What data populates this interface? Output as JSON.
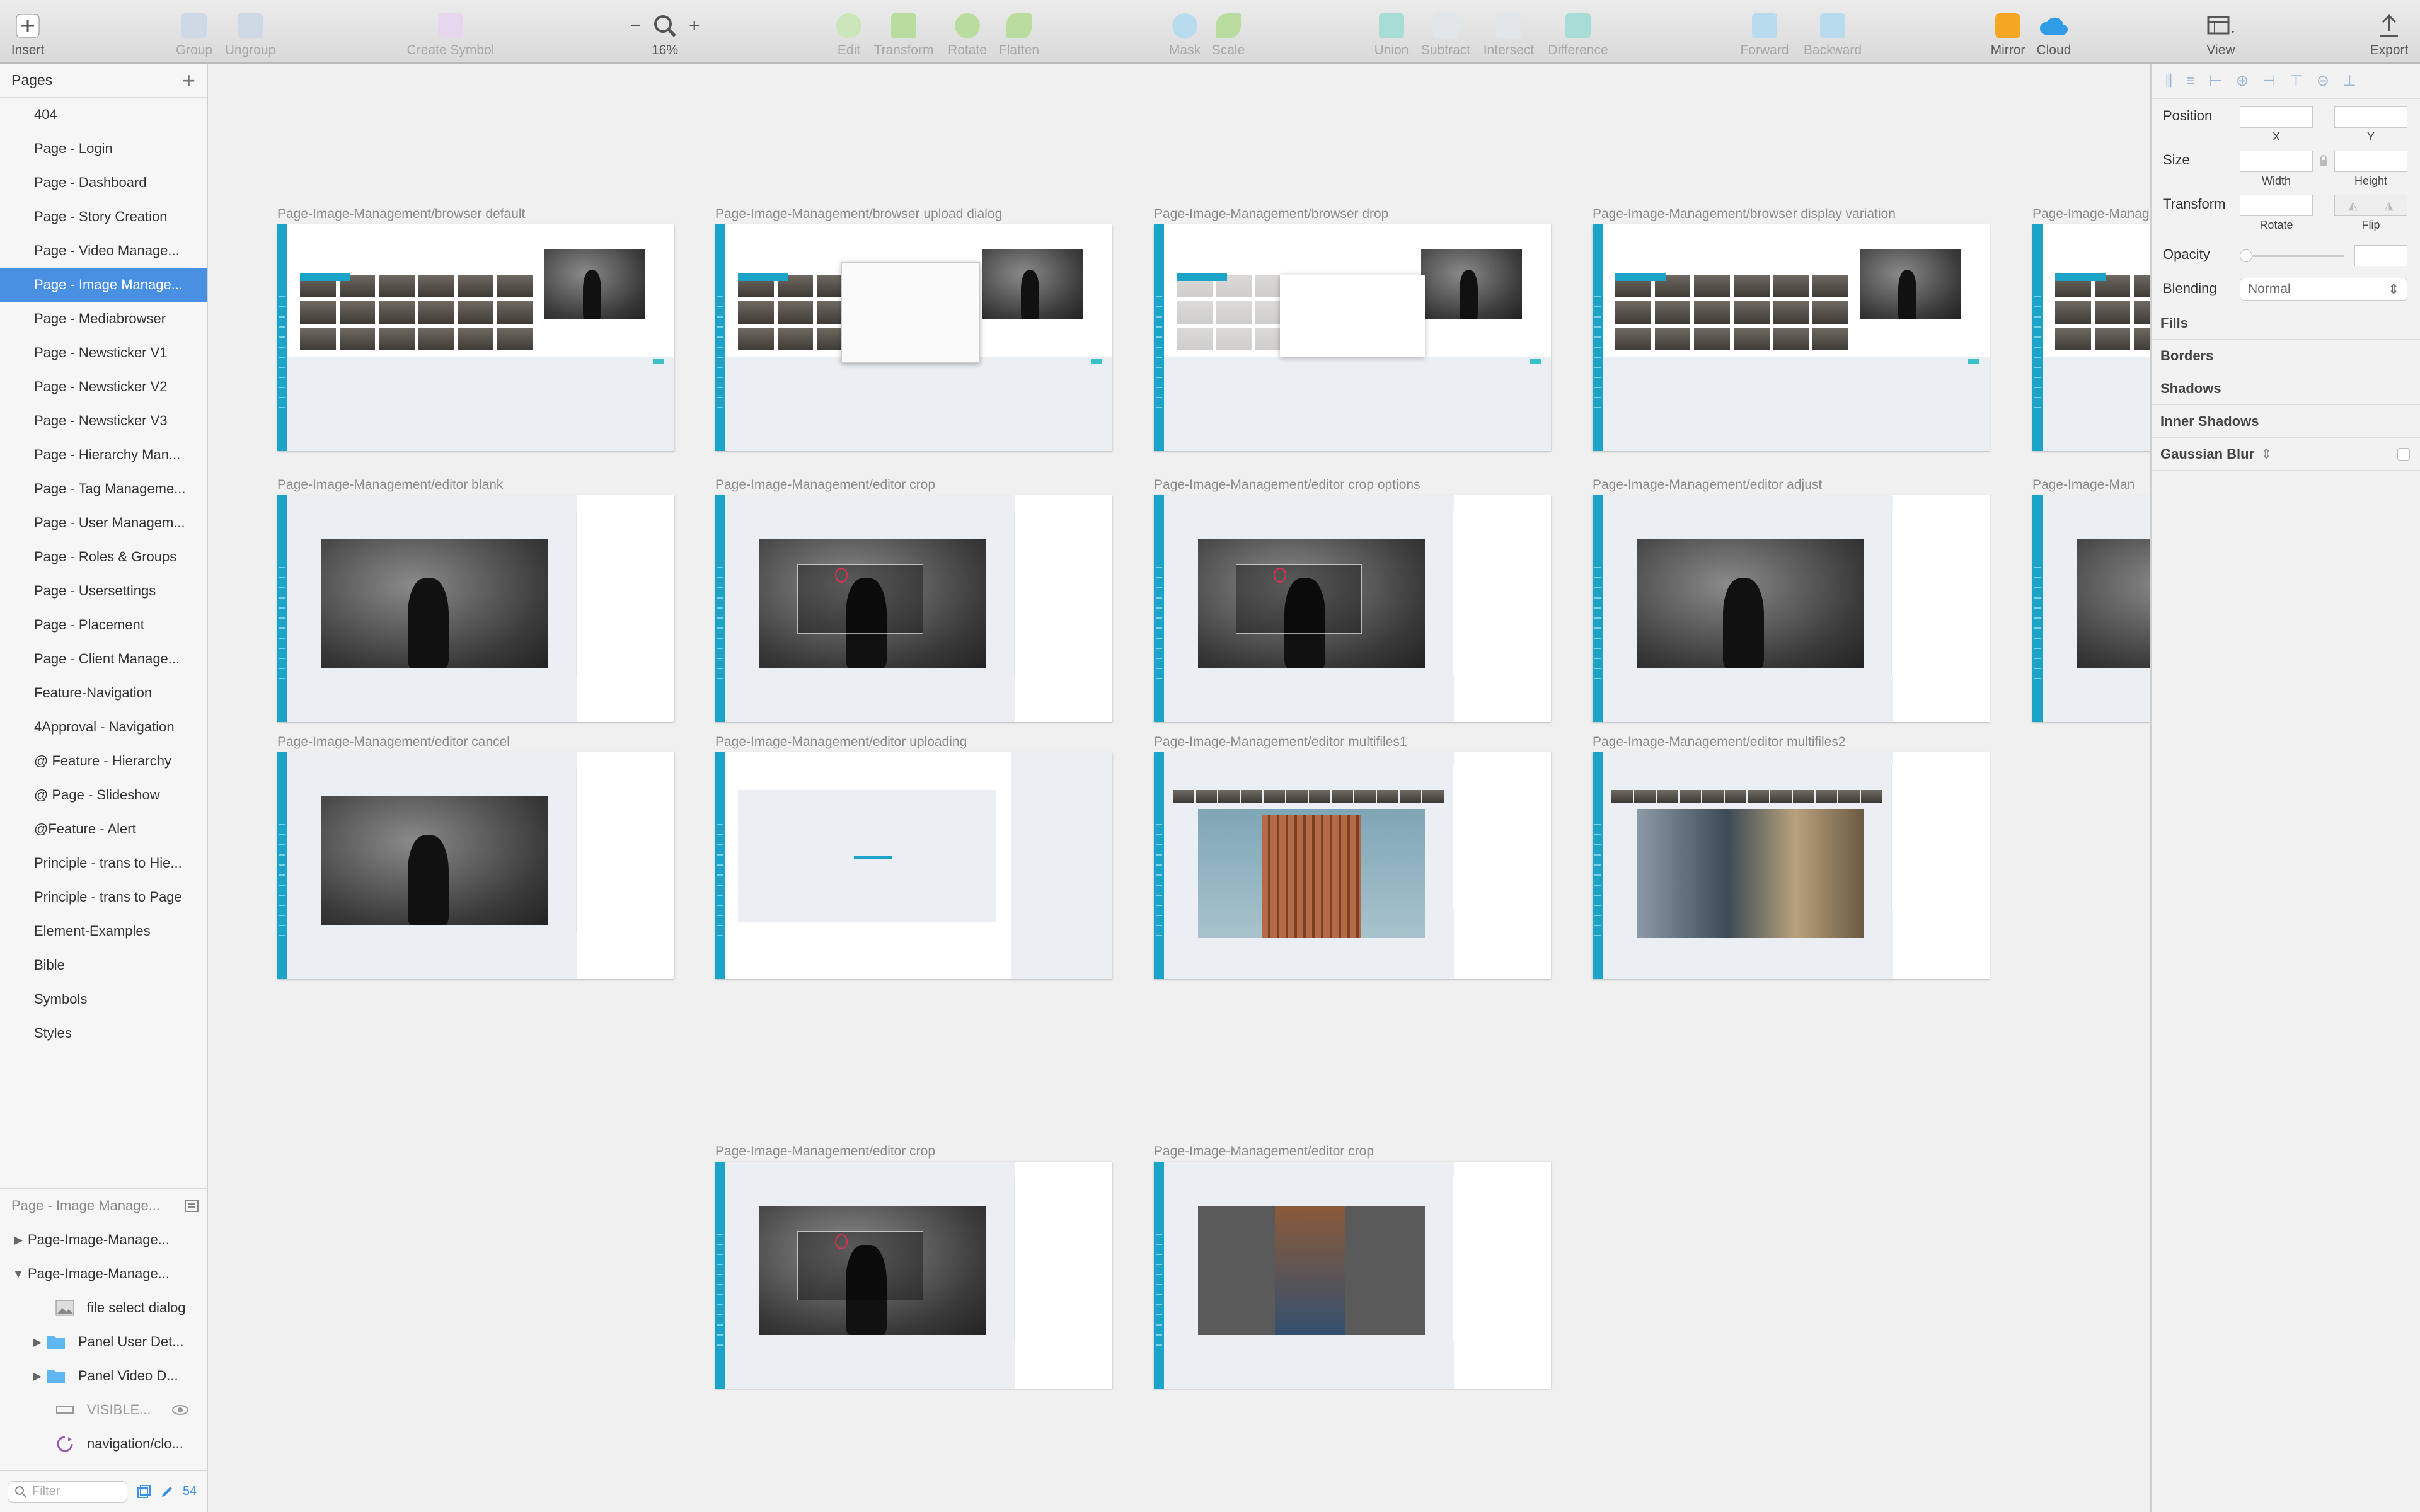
{
  "toolbar": {
    "insert": "Insert",
    "group": "Group",
    "ungroup": "Ungroup",
    "create_symbol": "Create Symbol",
    "zoom_minus": "−",
    "zoom_plus": "+",
    "zoom_value": "16%",
    "edit": "Edit",
    "transform": "Transform",
    "rotate": "Rotate",
    "flatten": "Flatten",
    "mask": "Mask",
    "scale": "Scale",
    "union": "Union",
    "subtract": "Subtract",
    "intersect": "Intersect",
    "difference": "Difference",
    "forward": "Forward",
    "backward": "Backward",
    "mirror": "Mirror",
    "cloud": "Cloud",
    "view": "View",
    "export": "Export"
  },
  "pages": {
    "title": "Pages",
    "items": [
      "404",
      "Page - Login",
      "Page - Dashboard",
      "Page - Story Creation",
      "Page - Video Manage...",
      "Page - Image Manage...",
      "Page - Mediabrowser",
      "Page - Newsticker V1",
      "Page - Newsticker V2",
      "Page - Newsticker V3",
      "Page - Hierarchy Man...",
      "Page - Tag Manageme...",
      "Page - User Managem...",
      "Page - Roles & Groups",
      "Page - Usersettings",
      "Page - Placement",
      "Page - Client Manage...",
      "Feature-Navigation",
      "4Approval - Navigation",
      "@ Feature - Hierarchy",
      "@ Page - Slideshow",
      "@Feature - Alert",
      "Principle - trans to Hie...",
      "Principle - trans to Page",
      "Element-Examples",
      "Bible",
      "Symbols",
      "Styles"
    ],
    "selected_index": 5
  },
  "layers": {
    "current_page": "Page - Image Manage...",
    "items": [
      {
        "label": "Page-Image-Manage...",
        "icon": "triangle-right"
      },
      {
        "label": "Page-Image-Manage...",
        "icon": "triangle-down"
      },
      {
        "label": "file select dialog",
        "icon": "image-icon"
      },
      {
        "label": "Panel User Det...",
        "icon": "folder-icon"
      },
      {
        "label": "Panel Video D...",
        "icon": "folder-icon"
      },
      {
        "label": "VISIBLE...",
        "icon": "rectangle-icon"
      },
      {
        "label": "navigation/clo...",
        "icon": "symbol-icon"
      }
    ],
    "filter_placeholder": "Filter",
    "count": "54"
  },
  "artboards": [
    {
      "title": "Page-Image-Management/browser default",
      "kind": "browser"
    },
    {
      "title": "Page-Image-Management/browser upload dialog",
      "kind": "upload"
    },
    {
      "title": "Page-Image-Management/browser drop",
      "kind": "drop"
    },
    {
      "title": "Page-Image-Management/browser display variation",
      "kind": "variation"
    },
    {
      "title": "Page-Image-Manag",
      "kind": "partial"
    },
    {
      "title": "Page-Image-Management/editor blank",
      "kind": "editor"
    },
    {
      "title": "Page-Image-Management/editor crop",
      "kind": "editor-crop"
    },
    {
      "title": "Page-Image-Management/editor crop options",
      "kind": "editor-crop"
    },
    {
      "title": "Page-Image-Management/editor adjust",
      "kind": "editor"
    },
    {
      "title": "Page-Image-Man",
      "kind": "partial-editor"
    },
    {
      "title": "Page-Image-Management/editor cancel",
      "kind": "editor"
    },
    {
      "title": "Page-Image-Management/editor uploading",
      "kind": "uploading"
    },
    {
      "title": "Page-Image-Management/editor multifiles1",
      "kind": "multi1"
    },
    {
      "title": "Page-Image-Management/editor multifiles2",
      "kind": "multi2"
    },
    {
      "title": "Page-Image-Management/editor crop",
      "kind": "editor-crop"
    },
    {
      "title": "Page-Image-Management/editor crop",
      "kind": "editor-crop2"
    }
  ],
  "inspector": {
    "position": "Position",
    "x": "X",
    "y": "Y",
    "size": "Size",
    "width": "Width",
    "height": "Height",
    "transform": "Transform",
    "rotate": "Rotate",
    "flip": "Flip",
    "opacity": "Opacity",
    "blending": "Blending",
    "blending_value": "Normal",
    "fills": "Fills",
    "borders": "Borders",
    "shadows": "Shadows",
    "inner_shadows": "Inner Shadows",
    "gaussian_blur": "Gaussian Blur"
  },
  "colors": {
    "selection": "#4a90e2",
    "brand_teal": "#1ba4c7",
    "accent_green": "#38c1c8"
  }
}
